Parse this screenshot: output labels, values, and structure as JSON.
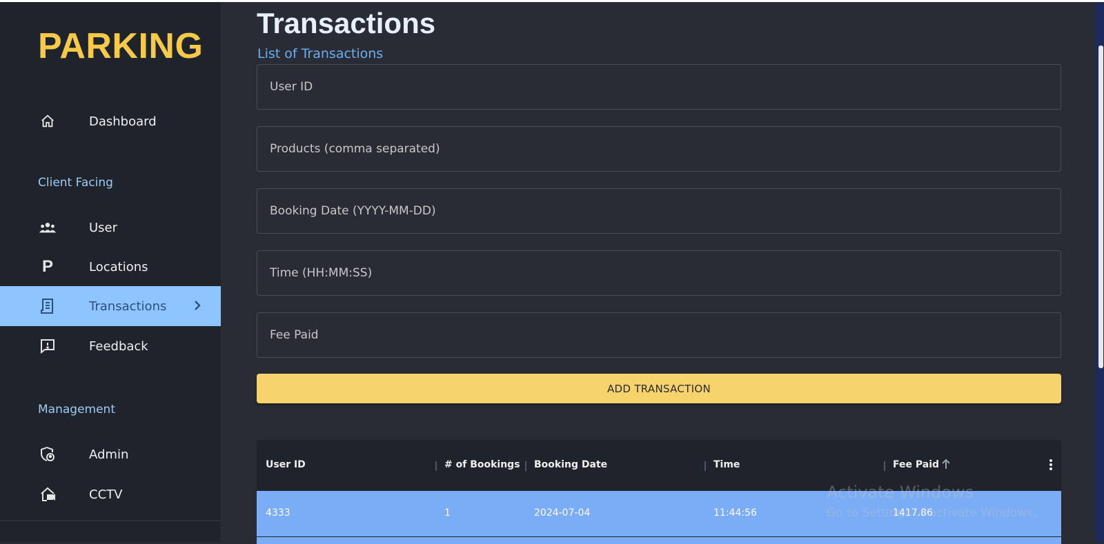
{
  "brand": "PARKING",
  "sidebar": {
    "dashboard": "Dashboard",
    "section_client": "Client Facing",
    "items_client": [
      "User",
      "Locations",
      "Transactions",
      "Feedback"
    ],
    "section_management": "Management",
    "items_management": [
      "Admin",
      "CCTV"
    ],
    "active": "Transactions"
  },
  "page": {
    "title": "Transactions",
    "subtitle": "List of Transactions"
  },
  "form": {
    "user_id_placeholder": "User ID",
    "products_placeholder": "Products (comma separated)",
    "booking_date_placeholder": "Booking Date (YYYY-MM-DD)",
    "time_placeholder": "Time (HH:MM:SS)",
    "fee_paid_placeholder": "Fee Paid",
    "submit_label": "ADD TRANSACTION"
  },
  "table": {
    "columns": [
      "User ID",
      "# of Bookings",
      "Booking Date",
      "Time",
      "Fee Paid"
    ],
    "rows": [
      [
        "4333",
        "1",
        "2024-07-04",
        "11:44:56",
        "1417.86"
      ]
    ]
  },
  "watermark": {
    "title": "Activate Windows",
    "subtitle": "Go to Settings to activate Windows."
  },
  "colors": {
    "brand": "#f7c948",
    "active_nav": "#8ec5ff",
    "button": "#f6d36b",
    "selected_row": "#7aadf5"
  }
}
